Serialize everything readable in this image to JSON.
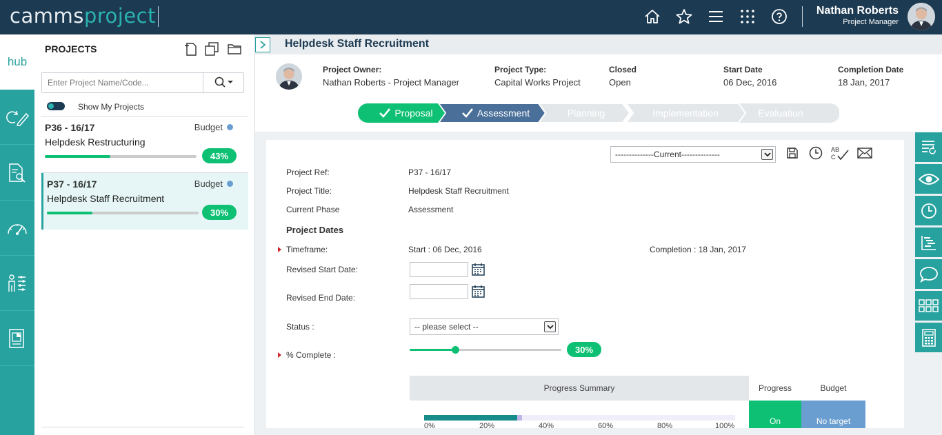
{
  "brand": {
    "part1": "camms",
    "part2": "project"
  },
  "user": {
    "name": "Nathan Roberts",
    "role": "Project Manager"
  },
  "nav": {
    "hub_label": "hub",
    "top_icons": [
      "home-icon",
      "star-icon",
      "menu-icon",
      "apps-grid-icon",
      "help-icon"
    ],
    "left_items": [
      "edit-cycle-icon",
      "document-search-icon",
      "gauge-icon",
      "people-chart-icon",
      "report-icon"
    ],
    "right_items": [
      "list-refresh-icon",
      "eye-icon",
      "clock-icon",
      "gantt-icon",
      "comment-icon",
      "grid-icon",
      "calculator-icon"
    ]
  },
  "projects_panel": {
    "title": "PROJECTS",
    "search_placeholder": "Enter Project Name/Code...",
    "toggle_label": "Show My Projects",
    "items": [
      {
        "code": "P36 - 16/17",
        "budget_label": "Budget",
        "name": "Helpdesk Restructuring",
        "progress": 43,
        "progress_label": "43%"
      },
      {
        "code": "P37 - 16/17",
        "budget_label": "Budget",
        "name": "Helpdesk Staff Recruitment",
        "progress": 30,
        "progress_label": "30%"
      }
    ]
  },
  "header": {
    "title": "Helpdesk Staff Recruitment",
    "owner_label": "Project Owner:",
    "owner_value": "Nathan Roberts - Project Manager",
    "type_label": "Project Type:",
    "type_value": "Capital Works Project",
    "closed_label": "Closed",
    "closed_value": "Open",
    "start_label": "Start Date",
    "start_value": "06 Dec, 2016",
    "completion_label": "Completion Date",
    "completion_value": "18 Jan, 2017"
  },
  "phases": [
    {
      "label": "Proposal",
      "state": "done"
    },
    {
      "label": "Assessment",
      "state": "current"
    },
    {
      "label": "Planning",
      "state": "pending"
    },
    {
      "label": "Implementation",
      "state": "pending"
    },
    {
      "label": "Evaluation",
      "state": "pending"
    }
  ],
  "form": {
    "version_select": "--------------Current--------------",
    "ref_label": "Project Ref:",
    "ref_value": "P37 - 16/17",
    "title_label": "Project Title:",
    "title_value": "Helpdesk Staff Recruitment",
    "phase_label": "Current Phase",
    "phase_value": "Assessment",
    "dates_section": "Project Dates",
    "timeframe_label": "Timeframe:",
    "timeframe_start": "Start : 06 Dec, 2016",
    "timeframe_completion": "Completion : 18 Jan, 2017",
    "revised_start_label": "Revised Start Date:",
    "revised_start_value": "",
    "revised_end_label": "Revised End Date:",
    "revised_end_value": "",
    "status_label": "Status :",
    "status_value": "-- please select --",
    "complete_label": "% Complete :",
    "complete_value": 30,
    "complete_pill": "30%"
  },
  "progress_summary": {
    "title": "Progress Summary",
    "progress_header": "Progress",
    "budget_header": "Budget",
    "progress_status": "On",
    "budget_status": "No target",
    "bar_value": 30,
    "bar_secondary": 31.5,
    "ticks": [
      "0%",
      "20%",
      "40%",
      "60%",
      "80%",
      "100%"
    ],
    "colors": {
      "on": "#0ec074",
      "no_target": "#6a9ed0",
      "bar": "#168d8a"
    }
  }
}
